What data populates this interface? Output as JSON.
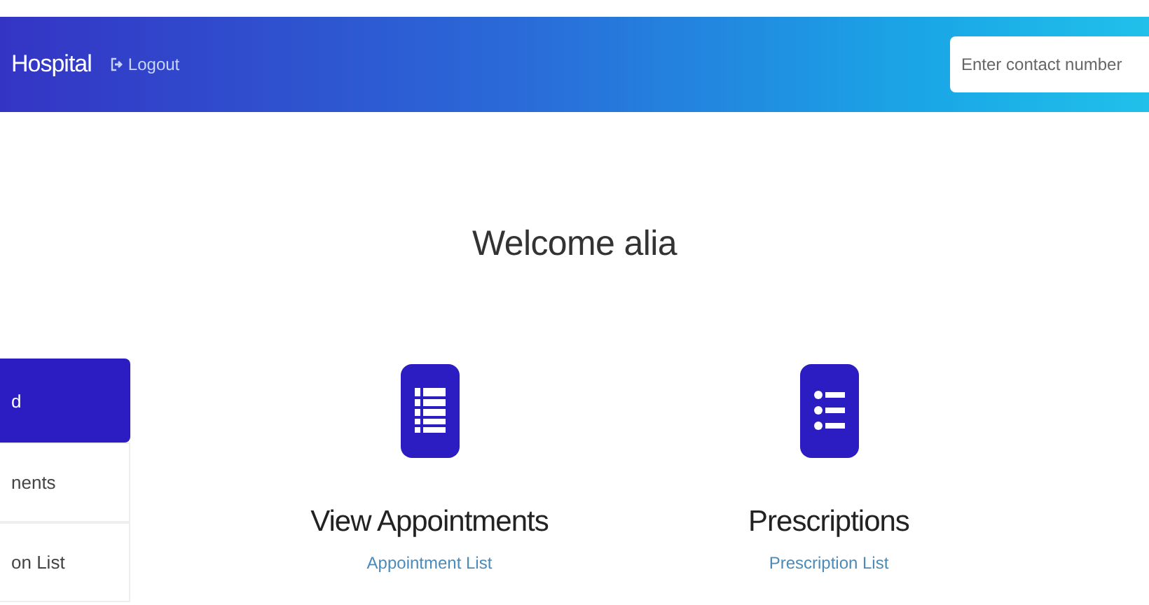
{
  "header": {
    "title": "Hospital",
    "logout": "Logout",
    "search": {
      "placeholder": "Enter contact number"
    }
  },
  "welcome": "Welcome  alia",
  "sidebar": {
    "items": [
      {
        "label": "d",
        "selected": true
      },
      {
        "label": "nents",
        "selected": false
      },
      {
        "label": "on List",
        "selected": false
      }
    ]
  },
  "cards": [
    {
      "kind": "table",
      "title": "View Appointments",
      "link": "Appointment List"
    },
    {
      "kind": "list",
      "title": "Prescriptions",
      "link": "Prescription List"
    }
  ]
}
